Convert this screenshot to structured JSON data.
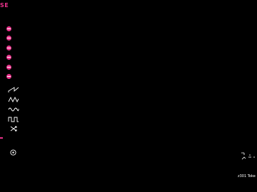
{
  "app": {
    "logo_text": "SE",
    "accent_color": "#e8318a"
  },
  "pads": [
    {
      "name": "pad-1",
      "icon": "minus-circle-icon"
    },
    {
      "name": "pad-2",
      "icon": "minus-circle-icon"
    },
    {
      "name": "pad-3",
      "icon": "minus-circle-icon"
    },
    {
      "name": "pad-4",
      "icon": "minus-circle-icon"
    },
    {
      "name": "pad-5",
      "icon": "minus-circle-icon"
    },
    {
      "name": "pad-6",
      "icon": "minus-circle-icon"
    }
  ],
  "waveforms": [
    {
      "name": "sawtooth",
      "icon": "sawtooth-wave-icon"
    },
    {
      "name": "triangle",
      "icon": "triangle-wave-icon"
    },
    {
      "name": "sine",
      "icon": "sine-wave-icon"
    },
    {
      "name": "square",
      "icon": "square-wave-icon"
    },
    {
      "name": "random",
      "icon": "shuffle-icon"
    }
  ],
  "settings_icon": "settings-icon",
  "status": {
    "text": "z301 Toke"
  }
}
